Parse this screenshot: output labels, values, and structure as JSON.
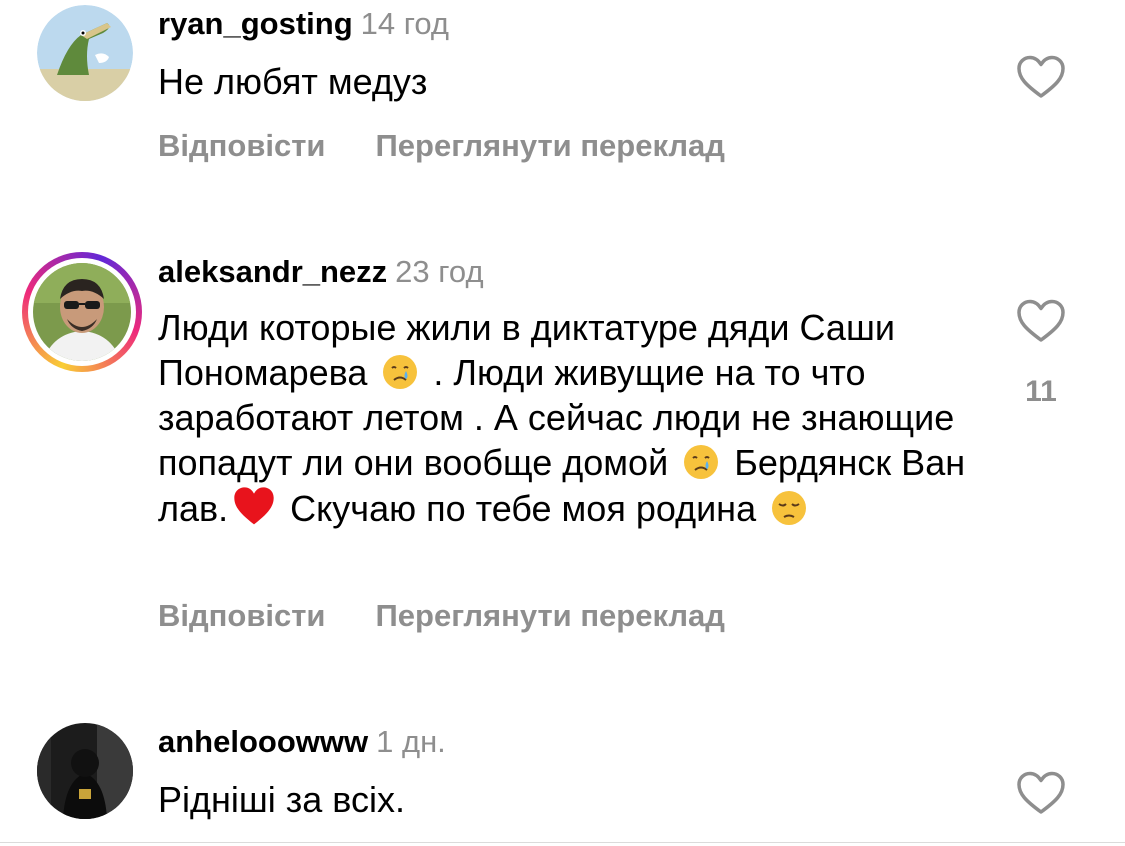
{
  "comments": [
    {
      "username": "ryan_gosting",
      "time": "14 год",
      "text": "Не любят медуз",
      "reply_label": "Відповісти",
      "translate_label": "Переглянути переклад",
      "avatar_icon": "crocodile-avatar",
      "like_count": ""
    },
    {
      "username": "aleksandr_nezz",
      "time": "23 год",
      "text_parts": [
        "Люди которые жили в диктатуре дяди Саши Пономарева ",
        " . Люди живущие на то что заработают летом .  А сейчас люди не знающие попадут ли они вообще домой ",
        " Бердянск Ван лав.",
        " Скучаю по тебе моя родина "
      ],
      "emojis": [
        "crying-face",
        "crying-face",
        "red-heart",
        "pensive-face"
      ],
      "reply_label": "Відповісти",
      "translate_label": "Переглянути переклад",
      "avatar_icon": "man-sunglasses-avatar",
      "like_count": "11"
    },
    {
      "username": "anhelooowww",
      "time": "1 дн.",
      "text": "Рідніші за всіх.",
      "avatar_icon": "dark-hoodie-avatar",
      "like_count": ""
    }
  ],
  "colors": {
    "secondary_text": "#8e8e8e",
    "primary_text": "#000000",
    "story_ring_start": "#f9ce34",
    "story_ring_mid": "#ee2a7b",
    "story_ring_end": "#6228d7"
  }
}
